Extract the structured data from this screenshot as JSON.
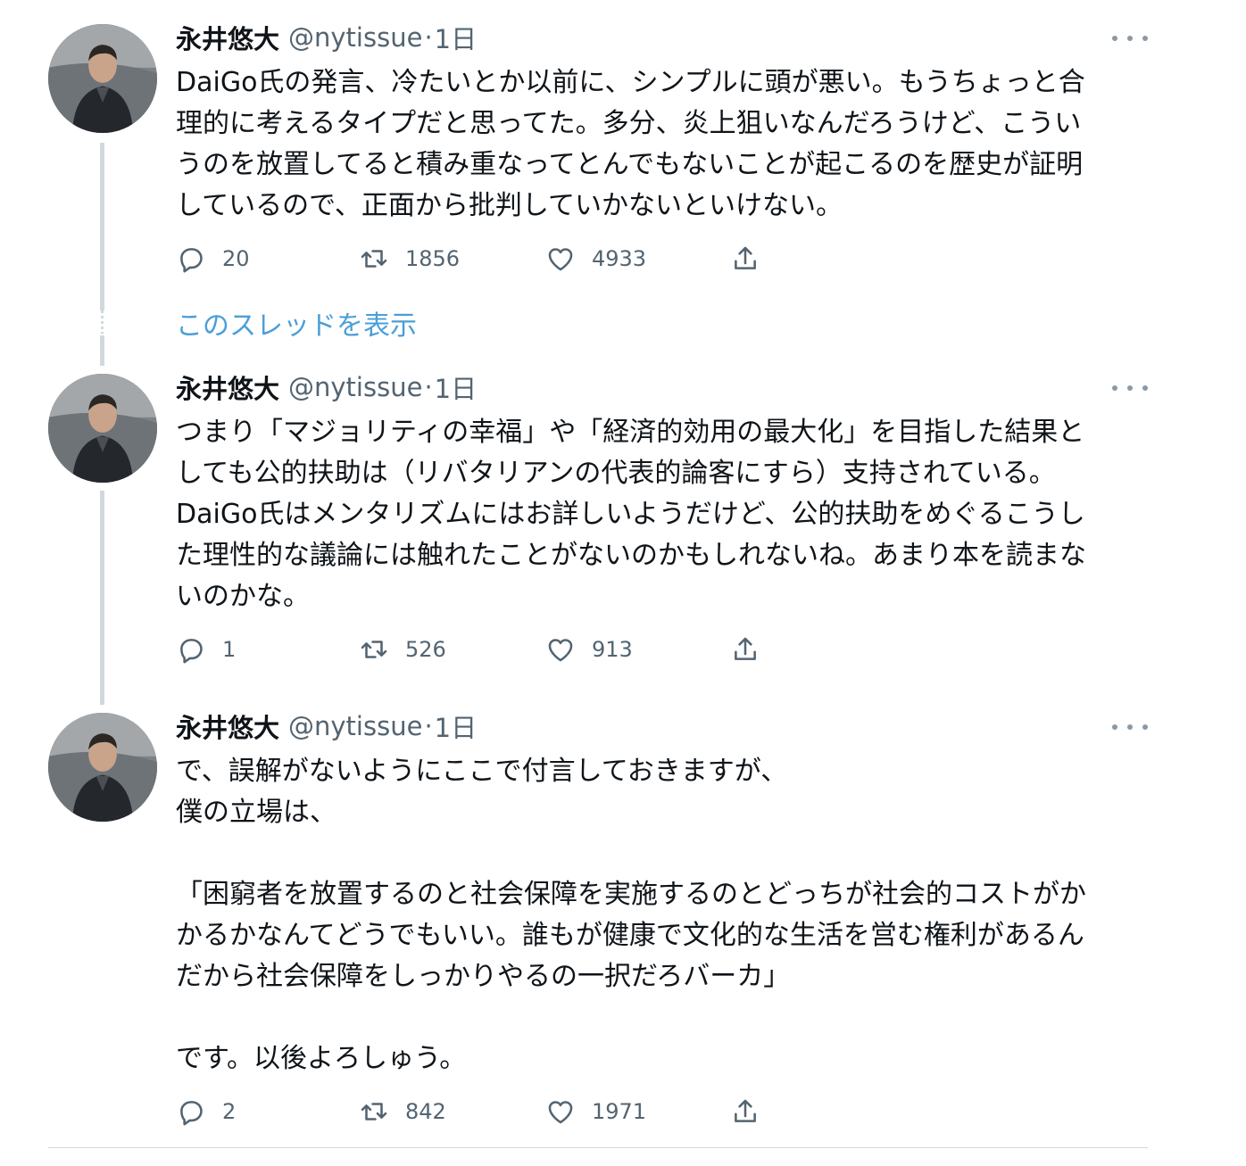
{
  "colors": {
    "link": "#4a9fd8",
    "secondary_text": "#536471",
    "thread_line": "#cfd9de"
  },
  "tweets": [
    {
      "name": "永井悠大",
      "handle": "@nytissue",
      "dot": "·",
      "time": "1日",
      "text": "DaiGo氏の発言、冷たいとか以前に、シンプルに頭が悪い。もうちょっと合\n理的に考えるタイプだと思ってた。多分、炎上狙いなんだろうけど、こうい\nうのを放置してると積み重なってとんでもないことが起こるのを歴史が証明\nしているので、正面から批判していかないといけない。",
      "replies": "20",
      "retweets": "1856",
      "likes": "4933",
      "icons": [
        "reply-icon",
        "retweet-icon",
        "like-icon",
        "share-icon"
      ]
    },
    {
      "name": "永井悠大",
      "handle": "@nytissue",
      "dot": "·",
      "time": "1日",
      "text": "つまり「マジョリティの幸福」や「経済的効用の最大化」を目指した結果と\nしても公的扶助は（リバタリアンの代表的論客にすら）支持されている。\nDaiGo氏はメンタリズムにはお詳しいようだけど、公的扶助をめぐるこうし\nた理性的な議論には触れたことがないのかもしれないね。あまり本を読まな\nいのかな。",
      "replies": "1",
      "retweets": "526",
      "likes": "913",
      "icons": [
        "reply-icon",
        "retweet-icon",
        "like-icon",
        "share-icon"
      ]
    },
    {
      "name": "永井悠大",
      "handle": "@nytissue",
      "dot": "·",
      "time": "1日",
      "text": "で、誤解がないようにここで付言しておきますが、\n僕の立場は、\n\n「困窮者を放置するのと社会保障を実施するのとどっちが社会的コストがか\nかるかなんてどうでもいい。誰もが健康で文化的な生活を営む権利があるん\nだから社会保障をしっかりやるの一択だろバーカ」\n\nです。以後よろしゅう。",
      "replies": "2",
      "retweets": "842",
      "likes": "1971",
      "icons": [
        "reply-icon",
        "retweet-icon",
        "like-icon",
        "share-icon"
      ]
    }
  ],
  "show_thread_label": "このスレッドを表示"
}
